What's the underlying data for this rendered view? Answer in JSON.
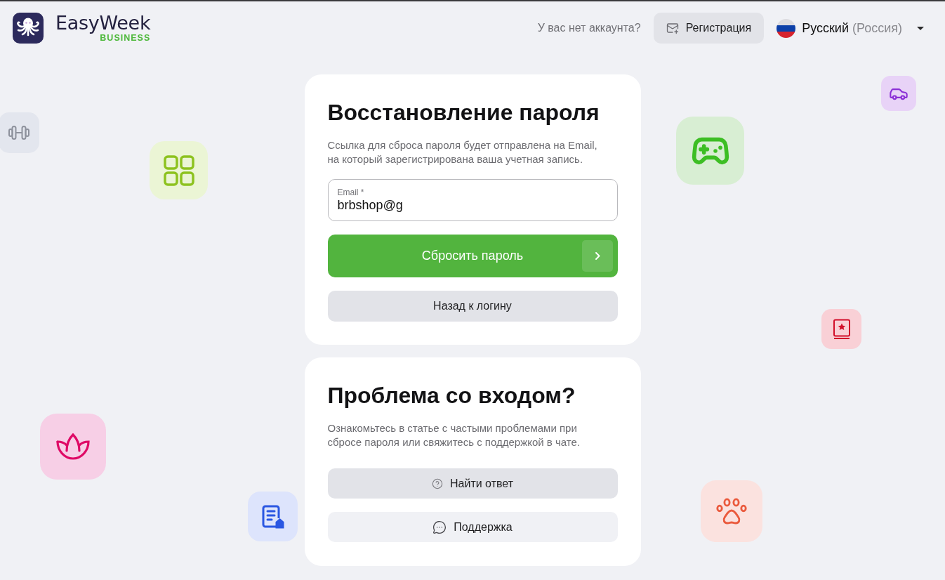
{
  "header": {
    "logo": {
      "name": "EasyWeek",
      "tagline": "BUSINESS"
    },
    "no_account_prompt": "У вас нет аккаунта?",
    "register_button": "Регистрация",
    "language": {
      "name": "Русский",
      "region": "(Россия)"
    }
  },
  "reset_card": {
    "title": "Восстановление пароля",
    "description": "Ссылка для сброса пароля будет отправлена на Email,\nна который зарегистрирована ваша учетная запись.",
    "email_field": {
      "label": "Email *",
      "value": "brbshop@g"
    },
    "submit_button": "Сбросить пароль",
    "back_button": "Назад к логину"
  },
  "help_card": {
    "title": "Проблема со входом?",
    "description": "Ознакомьтесь в статье с частыми проблемами при\nсбросе пароля или свяжитесь с поддержкой в чате.",
    "buttons": [
      {
        "kind": "faq",
        "label": "Найти ответ"
      },
      {
        "kind": "chat",
        "label": "Поддержка"
      }
    ]
  }
}
